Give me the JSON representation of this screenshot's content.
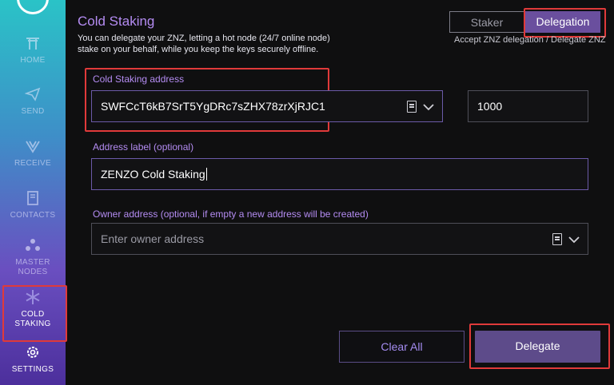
{
  "sidebar": {
    "items": [
      {
        "label": "HOME",
        "icon": "torii-gate-icon"
      },
      {
        "label": "SEND",
        "icon": "paper-plane-icon"
      },
      {
        "label": "RECEIVE",
        "icon": "receive-v-icon"
      },
      {
        "label": "CONTACTS",
        "icon": "address-book-icon"
      },
      {
        "label": "MASTER NODES",
        "icon": "nodes-icon"
      },
      {
        "label": "COLD STAKING",
        "icon": "snowflake-icon"
      },
      {
        "label": "SETTINGS",
        "icon": "gear-icon"
      }
    ]
  },
  "page": {
    "title": "Cold Staking",
    "description": "You can delegate your ZNZ, letting a hot node (24/7 online node) stake on your behalf, while you keep the keys securely offline."
  },
  "tabs": {
    "staker": "Staker",
    "delegation": "Delegation",
    "hint": "Accept ZNZ delegation / Delegate ZNZ"
  },
  "form": {
    "cold_address_label": "Cold Staking address",
    "cold_address_value": "SWFCcT6kB7SrT5YgDRc7sZHX78zrXjRJC1",
    "amount_value": "1000",
    "address_label_label": "Address label (optional)",
    "address_label_value": "ZENZO Cold Staking",
    "owner_label": "Owner address (optional, if empty a new address will be created)",
    "owner_placeholder": "Enter owner address"
  },
  "buttons": {
    "clear_all": "Clear All",
    "delegate": "Delegate"
  },
  "colors": {
    "accent": "#b48cf2",
    "button": "#5d4b8a",
    "highlight": "#e03a3a"
  }
}
